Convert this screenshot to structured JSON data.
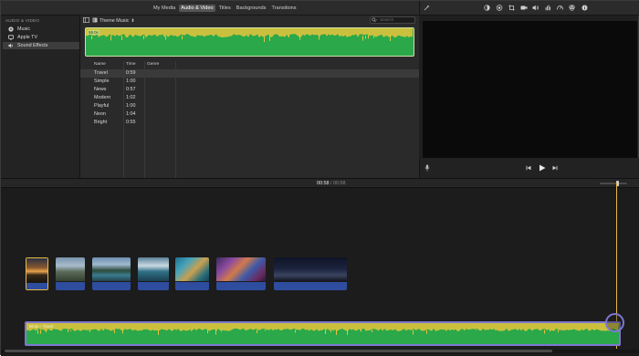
{
  "top_tabs": [
    {
      "label": "My Media"
    },
    {
      "label": "Audio & Video"
    },
    {
      "label": "Titles"
    },
    {
      "label": "Backgrounds"
    },
    {
      "label": "Transitions"
    }
  ],
  "active_tab_index": 1,
  "sidebar": {
    "header": "AUDIO & VIDEO",
    "items": [
      {
        "label": "Music",
        "icon": "music-icon"
      },
      {
        "label": "Apple TV",
        "icon": "tv-icon"
      },
      {
        "label": "Sound Effects",
        "icon": "speaker-icon"
      }
    ],
    "selected_index": 2
  },
  "browser": {
    "source_label": "Theme Music",
    "search_placeholder": "Search",
    "clip_duration": "58.0s",
    "columns": [
      "Name",
      "Time",
      "Genre"
    ],
    "rows": [
      {
        "name": "Travel",
        "time": "0:59"
      },
      {
        "name": "Simple",
        "time": "1:00"
      },
      {
        "name": "News",
        "time": "0:57"
      },
      {
        "name": "Modern",
        "time": "1:02"
      },
      {
        "name": "Playful",
        "time": "1:00"
      },
      {
        "name": "Neon",
        "time": "1:04"
      },
      {
        "name": "Bright",
        "time": "0:55"
      }
    ],
    "selected_row_index": 0
  },
  "timeline": {
    "current_time": "00:58",
    "separator": "/",
    "total_time": "00:58",
    "audio_track_label": "58.0s – Travel"
  },
  "colors": {
    "waveform_green": "#2aa84a",
    "waveform_yellow": "#e8c43c",
    "highlight_purple": "#7f76d2",
    "playhead_yellow": "#e5b84b",
    "clip_audio_blue": "#2f4d9e"
  }
}
